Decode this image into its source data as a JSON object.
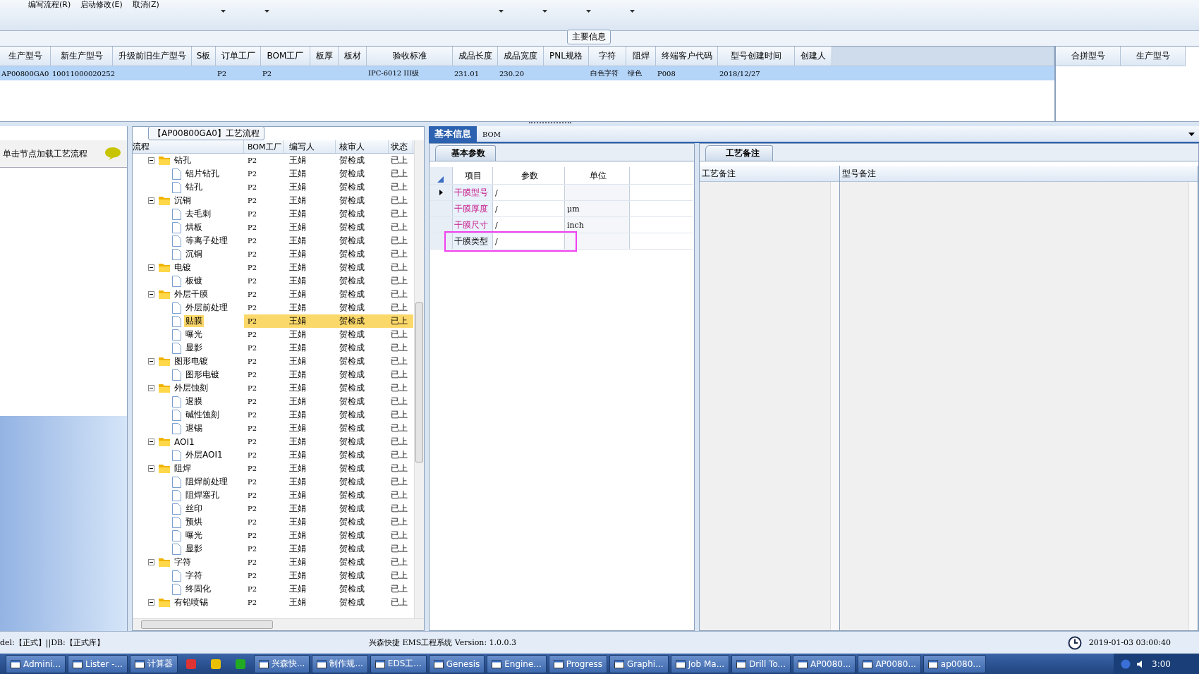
{
  "toolbar": {
    "items": [
      {
        "label": "编写流程(R)"
      },
      {
        "label": "启动修改(E)"
      },
      {
        "label": "取消(Z)"
      }
    ]
  },
  "main_info": {
    "title": "主要信息",
    "columns": [
      "生产型号",
      "新生产型号",
      "升级前旧生产型号",
      "S板",
      "订单工厂",
      "BOM工厂",
      "板厚",
      "板材",
      "验收标准",
      "成品长度",
      "成品宽度",
      "PNL规格",
      "字符",
      "阻焊",
      "终端客户代码",
      "型号创建时间",
      "创建人"
    ],
    "rows": [
      {
        "selected": true,
        "cells": [
          "AP00800GA0",
          "10011000020252",
          "",
          "",
          "P2",
          "P2",
          "",
          "",
          "IPC-6012 III级",
          "231.01",
          "230.20",
          "",
          "白色字符",
          "绿色",
          "P008",
          "2018/12/27",
          ""
        ]
      }
    ],
    "side_columns": [
      "合拼型号",
      "生产型号"
    ]
  },
  "left_panel": {
    "hint": "单击节点加载工艺流程"
  },
  "process_tree": {
    "title": "【AP00800GA0】工艺流程",
    "columns": [
      "流程",
      "BOM工厂",
      "编写人",
      "核审人",
      "状态"
    ],
    "nodes": [
      {
        "name": "钻孔",
        "bom": "P2",
        "writer": "王娟",
        "reviewer": "贺检成",
        "status": "已上",
        "selected": false,
        "expanded": true,
        "children": [
          {
            "name": "铝片钻孔",
            "bom": "P2",
            "writer": "王娟",
            "reviewer": "贺检成",
            "status": "已上",
            "selected": false
          },
          {
            "name": "钻孔",
            "bom": "P2",
            "writer": "王娟",
            "reviewer": "贺检成",
            "status": "已上",
            "selected": false
          }
        ]
      },
      {
        "name": "沉铜",
        "bom": "P2",
        "writer": "王娟",
        "reviewer": "贺检成",
        "status": "已上",
        "selected": false,
        "expanded": true,
        "children": [
          {
            "name": "去毛刺",
            "bom": "P2",
            "writer": "王娟",
            "reviewer": "贺检成",
            "status": "已上",
            "selected": false
          },
          {
            "name": "烘板",
            "bom": "P2",
            "writer": "王娟",
            "reviewer": "贺检成",
            "status": "已上",
            "selected": false
          },
          {
            "name": "等离子处理",
            "bom": "P2",
            "writer": "王娟",
            "reviewer": "贺检成",
            "status": "已上",
            "selected": false
          },
          {
            "name": "沉铜",
            "bom": "P2",
            "writer": "王娟",
            "reviewer": "贺检成",
            "status": "已上",
            "selected": false
          }
        ]
      },
      {
        "name": "电镀",
        "bom": "P2",
        "writer": "王娟",
        "reviewer": "贺检成",
        "status": "已上",
        "selected": false,
        "expanded": true,
        "children": [
          {
            "name": "板镀",
            "bom": "P2",
            "writer": "王娟",
            "reviewer": "贺检成",
            "status": "已上",
            "selected": false
          }
        ]
      },
      {
        "name": "外层干膜",
        "bom": "P2",
        "writer": "王娟",
        "reviewer": "贺检成",
        "status": "已上",
        "selected": false,
        "expanded": true,
        "children": [
          {
            "name": "外层前处理",
            "bom": "P2",
            "writer": "王娟",
            "reviewer": "贺检成",
            "status": "已上",
            "selected": false
          },
          {
            "name": "贴膜",
            "bom": "P2",
            "writer": "王娟",
            "reviewer": "贺检成",
            "status": "已上",
            "selected": true
          },
          {
            "name": "曝光",
            "bom": "P2",
            "writer": "王娟",
            "reviewer": "贺检成",
            "status": "已上",
            "selected": false
          },
          {
            "name": "显影",
            "bom": "P2",
            "writer": "王娟",
            "reviewer": "贺检成",
            "status": "已上",
            "selected": false
          }
        ]
      },
      {
        "name": "图形电镀",
        "bom": "P2",
        "writer": "王娟",
        "reviewer": "贺检成",
        "status": "已上",
        "selected": false,
        "expanded": true,
        "children": [
          {
            "name": "图形电镀",
            "bom": "P2",
            "writer": "王娟",
            "reviewer": "贺检成",
            "status": "已上",
            "selected": false
          }
        ]
      },
      {
        "name": "外层蚀刻",
        "bom": "P2",
        "writer": "王娟",
        "reviewer": "贺检成",
        "status": "已上",
        "selected": false,
        "expanded": true,
        "children": [
          {
            "name": "退膜",
            "bom": "P2",
            "writer": "王娟",
            "reviewer": "贺检成",
            "status": "已上",
            "selected": false
          },
          {
            "name": "碱性蚀刻",
            "bom": "P2",
            "writer": "王娟",
            "reviewer": "贺检成",
            "status": "已上",
            "selected": false
          },
          {
            "name": "退锡",
            "bom": "P2",
            "writer": "王娟",
            "reviewer": "贺检成",
            "status": "已上",
            "selected": false
          }
        ]
      },
      {
        "name": "AOI1",
        "bom": "P2",
        "writer": "王娟",
        "reviewer": "贺检成",
        "status": "已上",
        "selected": false,
        "expanded": true,
        "children": [
          {
            "name": "外层AOI1",
            "bom": "P2",
            "writer": "王娟",
            "reviewer": "贺检成",
            "status": "已上",
            "selected": false
          }
        ]
      },
      {
        "name": "阻焊",
        "bom": "P2",
        "writer": "王娟",
        "reviewer": "贺检成",
        "status": "已上",
        "selected": false,
        "expanded": true,
        "children": [
          {
            "name": "阻焊前处理",
            "bom": "P2",
            "writer": "王娟",
            "reviewer": "贺检成",
            "status": "已上",
            "selected": false
          },
          {
            "name": "阻焊塞孔",
            "bom": "P2",
            "writer": "王娟",
            "reviewer": "贺检成",
            "status": "已上",
            "selected": false
          },
          {
            "name": "丝印",
            "bom": "P2",
            "writer": "王娟",
            "reviewer": "贺检成",
            "status": "已上",
            "selected": false
          },
          {
            "name": "预烘",
            "bom": "P2",
            "writer": "王娟",
            "reviewer": "贺检成",
            "status": "已上",
            "selected": false
          },
          {
            "name": "曝光",
            "bom": "P2",
            "writer": "王娟",
            "reviewer": "贺检成",
            "status": "已上",
            "selected": false
          },
          {
            "name": "显影",
            "bom": "P2",
            "writer": "王娟",
            "reviewer": "贺检成",
            "status": "已上",
            "selected": false
          }
        ]
      },
      {
        "name": "字符",
        "bom": "P2",
        "writer": "王娟",
        "reviewer": "贺检成",
        "status": "已上",
        "selected": false,
        "expanded": true,
        "children": [
          {
            "name": "字符",
            "bom": "P2",
            "writer": "王娟",
            "reviewer": "贺检成",
            "status": "已上",
            "selected": false
          },
          {
            "name": "终固化",
            "bom": "P2",
            "writer": "王娟",
            "reviewer": "贺检成",
            "status": "已上",
            "selected": false
          }
        ]
      },
      {
        "name": "有铅喷锡",
        "bom": "P2",
        "writer": "王娟",
        "reviewer": "贺检成",
        "status": "已上",
        "selected": false,
        "expanded": true
      }
    ]
  },
  "detail_tabs": [
    {
      "label": "基本信息",
      "selected": true
    },
    {
      "label": "BOM",
      "selected": false
    }
  ],
  "params": {
    "tab": "基本参数",
    "columns": [
      "项目",
      "参数",
      "单位"
    ],
    "rows": [
      {
        "item": "干膜型号",
        "value": "/",
        "required": true,
        "current": true,
        "marked": false
      },
      {
        "item": "干膜厚度",
        "value": "/",
        "unit": "μm",
        "required": true,
        "current": false,
        "marked": false
      },
      {
        "item": "干膜尺寸",
        "value": "/",
        "unit": "inch",
        "required": true,
        "current": false,
        "marked": false
      },
      {
        "item": "干膜类型",
        "value": "/",
        "required": false,
        "current": false,
        "marked": true
      }
    ]
  },
  "notes": {
    "tab": "工艺备注",
    "columns": [
      "工艺备注",
      "型号备注"
    ]
  },
  "status_bar": {
    "left": "del:【正式】||DB:【正式库】",
    "center": "兴森快捷 EMS工程系统 Version: 1.0.0.3",
    "datetime": "2019-01-03 03:00:40"
  },
  "taskbar": {
    "items": [
      {
        "label": "Admini...",
        "kind": "window"
      },
      {
        "label": "Lister -...",
        "kind": "window"
      },
      {
        "label": "计算器",
        "kind": "window"
      },
      {
        "kind": "icon"
      },
      {
        "kind": "icon"
      },
      {
        "kind": "icon"
      },
      {
        "label": "兴森快...",
        "kind": "window"
      },
      {
        "label": "制作规...",
        "kind": "window"
      },
      {
        "label": "EDS工...",
        "kind": "window"
      },
      {
        "label": "Genesis",
        "kind": "window"
      },
      {
        "label": "Engine...",
        "kind": "window"
      },
      {
        "label": "Progress",
        "kind": "window"
      },
      {
        "label": "Graphi...",
        "kind": "window"
      },
      {
        "label": "Job Ma...",
        "kind": "window"
      },
      {
        "label": "Drill To...",
        "kind": "window"
      },
      {
        "label": "AP0080...",
        "kind": "window"
      },
      {
        "label": "AP0080...",
        "kind": "window"
      },
      {
        "label": "ap0080...",
        "kind": "window"
      }
    ],
    "clock": "3:00"
  }
}
